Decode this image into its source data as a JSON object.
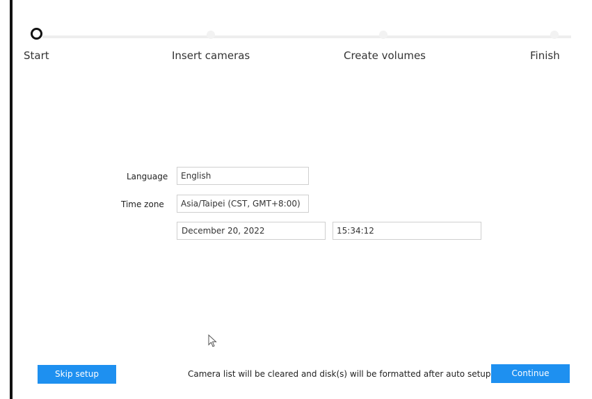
{
  "stepper": {
    "steps": [
      {
        "label": "Start",
        "state": "active"
      },
      {
        "label": "Insert cameras",
        "state": "pending"
      },
      {
        "label": "Create volumes",
        "state": "pending"
      },
      {
        "label": "Finish",
        "state": "pending"
      }
    ]
  },
  "form": {
    "language_label": "Language",
    "language_value": "English",
    "timezone_label": "Time zone",
    "timezone_value": "Asia/Taipei (CST, GMT+8:00)",
    "date_value": "December 20, 2022",
    "time_value": "15:34:12"
  },
  "footer": {
    "skip_label": "Skip setup",
    "notice": "Camera list will be cleared and disk(s) will be formatted after auto setup",
    "continue_label": "Continue"
  },
  "colors": {
    "accent": "#1e90f0",
    "step_active": "#111111",
    "step_pending": "#eeeeee"
  }
}
